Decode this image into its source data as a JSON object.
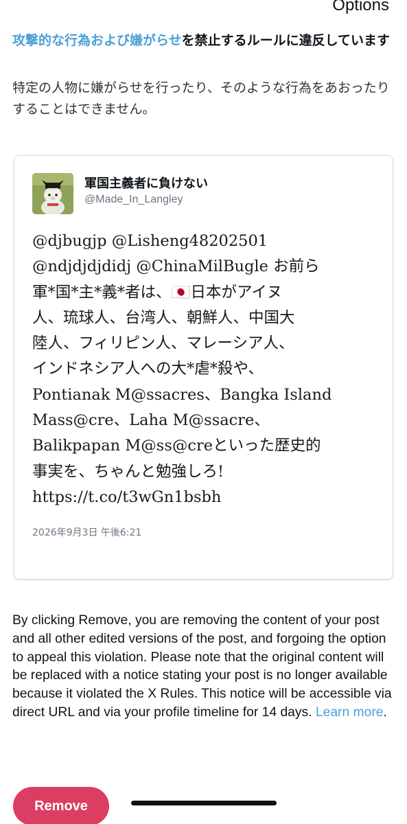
{
  "header": {
    "options_label": "Options"
  },
  "rule": {
    "link_text": "攻撃的な行為および嫌がらせ",
    "title_rest": "を禁止するルールに違反しています",
    "description": "特定の人物に嫌がらせを行ったり、そのような行為をあおったりすることはできません。"
  },
  "post": {
    "author_name": "軍国主義者に負けない",
    "author_handle": "@Made_In_Langley",
    "body": "@djbugjp @Lisheng48202501\n@ndjdjdjdidj @ChinaMilBugle お前ら\n軍*国*主*義*者は、🇯🇵日本がアイヌ\n人、琉球人、台湾人、朝鮮人、中国大\n陸人、フィリピン人、マレーシア人、\nインドネシア人への大*虐*殺や、\nPontianak M@ssacres、Bangka Island\nMass@cre、Laha M@ssacre、\nBalikpapan M@ss@creといった歴史的\n事実を、ちゃんと勉強しろ!\nhttps://t.co/t3wGn1bsbh",
    "timestamp": "2026年9月3日 午後6:21",
    "avatar_icon": "cartoon-character-avatar"
  },
  "notice": {
    "text": "By clicking Remove, you are removing the content of your post and all other edited versions of the post, and forgoing the option to appeal this violation. Please note that the original content will be replaced with a notice stating your post is no longer available because it violated the X Rules. This notice will be accessible via direct URL and via your profile timeline for 14 days. ",
    "learn_more": "Learn more",
    "period": "."
  },
  "actions": {
    "remove_label": "Remove"
  },
  "colors": {
    "link": "#4a9fd8",
    "remove_button": "#db3e62"
  }
}
